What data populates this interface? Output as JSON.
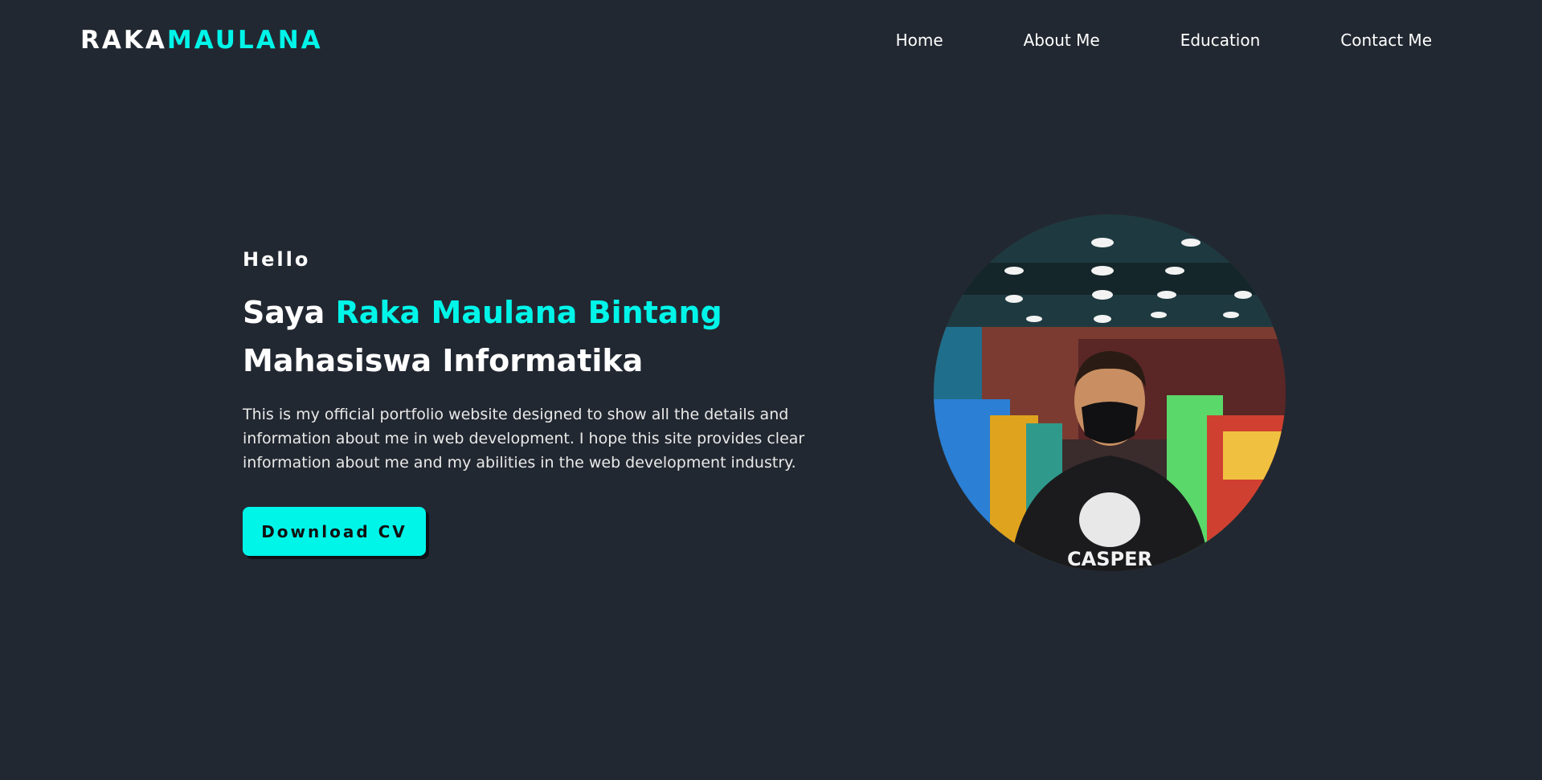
{
  "brand": {
    "part_a": "RAKA",
    "part_b": "MAULANA"
  },
  "nav": {
    "items": [
      {
        "label": "Home"
      },
      {
        "label": "About Me"
      },
      {
        "label": "Education"
      },
      {
        "label": "Contact Me"
      }
    ]
  },
  "hero": {
    "greeting": "Hello",
    "headline_prefix": "Saya",
    "name": "Raka Maulana Bintang",
    "role": "Mahasiswa Informatika",
    "description": "This is my official portfolio website designed to show all the details and information about me in web development. I hope this site provides clear information about me and my abilities in the web development industry.",
    "cta_label": "Download CV"
  },
  "photo": {
    "shirt_text": "CASPER"
  },
  "colors": {
    "background": "#222831",
    "accent": "#00f5e9",
    "text": "#ffffff"
  },
  "icons": {
    "photo": "profile-photo"
  }
}
